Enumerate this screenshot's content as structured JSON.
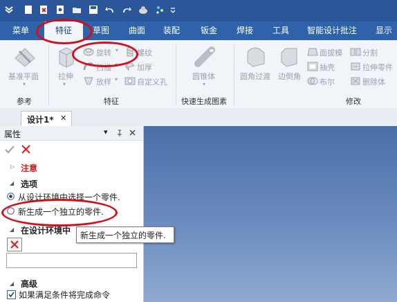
{
  "menu": {
    "tabs": [
      "菜单",
      "特征",
      "草图",
      "曲面",
      "装配",
      "钣金",
      "焊接",
      "工具",
      "智能设计批注",
      "显示"
    ],
    "active_index": 1
  },
  "ribbon": {
    "groups": {
      "reference": {
        "label": "参考",
        "items": {
          "datum_plane": "基准平面"
        }
      },
      "features": {
        "label": "特征",
        "items": {
          "extrude": "拉伸",
          "revolve": "旋转",
          "sweep": "扫描",
          "loft": "放样",
          "thread": "螺纹",
          "thicken": "加厚",
          "custom_hole": "自定义孔"
        }
      },
      "quick_primitive": {
        "label": "快速生成图素",
        "items": {
          "cone": "圆锥体"
        }
      },
      "modify": {
        "label": "修改",
        "items": {
          "fillet": "圆角过渡",
          "chamfer": "边倒角",
          "draft": "面拔模",
          "shell": "抽壳",
          "boolean": "布尔",
          "split": "分割",
          "extrude_to_part": "拉伸零件",
          "delete_body": "删除体"
        }
      }
    }
  },
  "document": {
    "tab_label": "设计1*",
    "close_glyph": "✕"
  },
  "properties": {
    "title": "属性",
    "pin_glyph": "▾",
    "sections": {
      "notes": "注意",
      "options": "选项",
      "option_select": "从设计环境中选择一个零件.",
      "option_new": "新生成一个独立的零件.",
      "select_in_env": "在设计环境中",
      "advanced": "高级",
      "auto_complete": "如果满足条件将完成命令"
    }
  },
  "tooltip": "新生成一个独立的零件.",
  "colors": {
    "accent_red": "#d10f1a",
    "titlebar": "#2b5699",
    "menubar": "#2e62aa"
  }
}
